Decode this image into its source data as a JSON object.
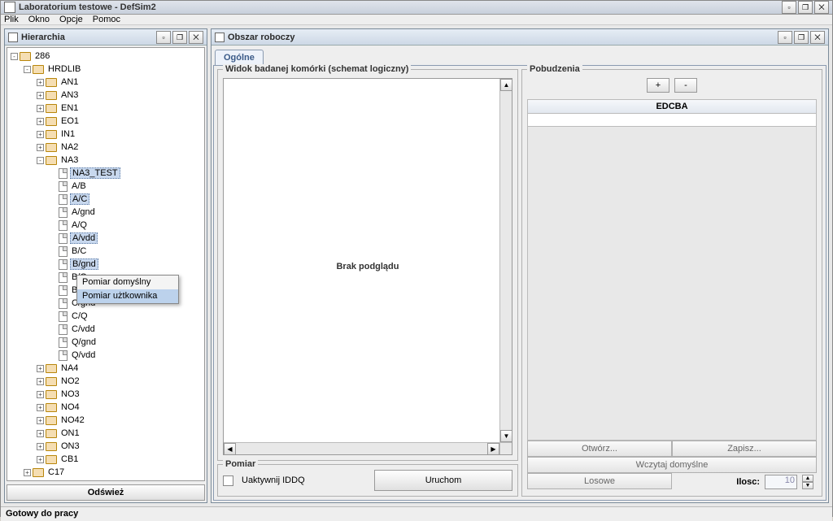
{
  "window": {
    "title": "Laboratorium testowe - DefSim2"
  },
  "menu": {
    "plik": "Plik",
    "okno": "Okno",
    "opcje": "Opcje",
    "pomoc": "Pomoc"
  },
  "left": {
    "title": "Hierarchia",
    "refresh": "Odśwież",
    "tree": {
      "root": "286",
      "lib": "HRDLIB",
      "groups_pre": [
        "AN1",
        "AN3",
        "EN1",
        "EO1",
        "IN1",
        "NA2"
      ],
      "open_group": "NA3",
      "files": [
        "NA3_TEST",
        "A/B",
        "A/C",
        "A/gnd",
        "A/Q",
        "A/vdd",
        "B/C",
        "B/gnd",
        "B/Q",
        "B/vdd",
        "C/gnd",
        "C/Q",
        "C/vdd",
        "Q/gnd",
        "Q/vdd"
      ],
      "selected_files": [
        "NA3_TEST",
        "A/C",
        "A/vdd",
        "B/gnd"
      ],
      "groups_post": [
        "NA4",
        "NO2",
        "NO3",
        "NO4",
        "NO42",
        "ON1",
        "ON3",
        "CB1"
      ],
      "sibling": "C17"
    }
  },
  "context_menu": {
    "item1": "Pomiar domyślny",
    "item2": "Pomiar użtkownika"
  },
  "right": {
    "title": "Obszar roboczy",
    "tab": "Ogólne",
    "schematic": {
      "title": "Widok badanej komórki (schemat logiczny)",
      "placeholder": "Brak podglądu"
    },
    "pomiar": {
      "title": "Pomiar",
      "checkbox_label": "Uaktywnij IDDQ",
      "run": "Uruchom"
    },
    "pobudzenia": {
      "title": "Pobudzenia",
      "plus": "+",
      "minus": "-",
      "header": "EDCBA",
      "open": "Otwórz...",
      "save": "Zapisz...",
      "load_default": "Wczytaj domyślne",
      "random": "Losowe",
      "ilosc_label": "Ilosc:",
      "ilosc_value": "10"
    }
  },
  "status": "Gotowy do pracy"
}
